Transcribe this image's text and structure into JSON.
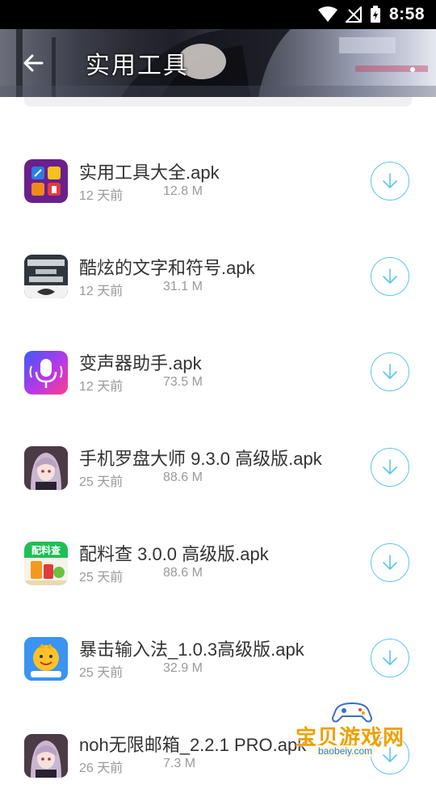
{
  "status_bar": {
    "time": "8:58"
  },
  "header": {
    "title": "实用工具"
  },
  "items": [
    {
      "name": "实用工具大全.apk",
      "date": "12 天前",
      "size": "12.8 M",
      "icon": "toolbox-app-icon"
    },
    {
      "name": "酷炫的文字和符号.apk",
      "date": "12 天前",
      "size": "31.1 M",
      "icon": "cool-text-app-icon"
    },
    {
      "name": "变声器助手.apk",
      "date": "12 天前",
      "size": "73.5 M",
      "icon": "voice-changer-app-icon"
    },
    {
      "name": "手机罗盘大师 9.3.0 高级版.apk",
      "date": "25 天前",
      "size": "88.6 M",
      "icon": "anime-avatar-app-icon"
    },
    {
      "name": "配料查 3.0.0 高级版.apk",
      "date": "25 天前",
      "size": "88.6 M",
      "icon": "ingredient-app-icon"
    },
    {
      "name": "暴击输入法_1.0.3高级版.apk",
      "date": "25 天前",
      "size": "32.9 M",
      "icon": "keyboard-app-icon"
    },
    {
      "name": "noh无限邮箱_2.2.1 PRO.apk",
      "date": "26 天前",
      "size": "7.3 M",
      "icon": "anime-avatar-app-icon"
    }
  ],
  "watermark": {
    "text": "宝贝游戏网",
    "url": "baobeiy.com"
  },
  "colors": {
    "accent": "#5bc7ea",
    "meta_text": "#9a9a9a"
  }
}
